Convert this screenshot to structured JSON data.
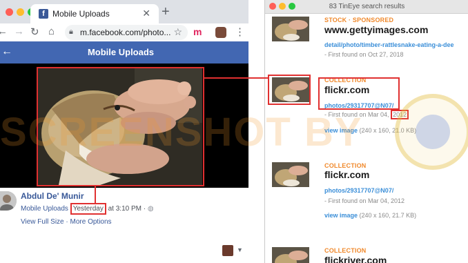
{
  "left_window": {
    "tab_title": "Mobile Uploads",
    "tab_favicon": "f",
    "url": "m.facebook.com/photo...",
    "extension_label": "m",
    "page_header": "Mobile Uploads",
    "author": "Abdul De' Munir",
    "album": "Mobile Uploads",
    "when": "Yesterday",
    "time": "at 3:10 PM",
    "separator": "·",
    "view_full_size": "View Full Size",
    "links_sep": "·",
    "more_options": "More Options"
  },
  "right_window": {
    "title": "83 TinEye search results",
    "results": [
      {
        "label": "STOCK · SPONSORED",
        "domain": "www.gettyimages.com",
        "path": "detail/photo/timber-rattlesnake-eating-a-dee",
        "found": "- First found on Oct 27, 2018"
      },
      {
        "label": "COLLECTION",
        "domain": "flickr.com",
        "path": "photos/29317707@N07/",
        "found_prefix": "- First found on Mar 04,",
        "found_year": "2012",
        "view_link": "view image",
        "view_info": "(240 x 160, 21.0 KB)"
      },
      {
        "label": "COLLECTION",
        "domain": "flickr.com",
        "path": "photos/29317707@N07/",
        "found": "- First found on Mar 04, 2012",
        "view_link": "view image",
        "view_info": "(240 x 160, 21.7 KB)"
      },
      {
        "label": "COLLECTION",
        "domain": "flickriver.com"
      }
    ]
  },
  "watermark": "SCREENSHOT BY",
  "colors": {
    "facebook_blue": "#4267b2",
    "link_blue": "#385898",
    "tineye_orange": "#f0882a",
    "tineye_link": "#3a8ed8",
    "highlight_red": "#e03030"
  },
  "icons": [
    "facebook-favicon",
    "close-tab-icon",
    "new-tab-icon",
    "back-arrow-icon",
    "forward-arrow-icon",
    "reload-icon",
    "home-icon",
    "lock-icon",
    "star-icon",
    "menu-kebab-icon",
    "back-icon",
    "globe-icon",
    "caret-down-icon"
  ]
}
